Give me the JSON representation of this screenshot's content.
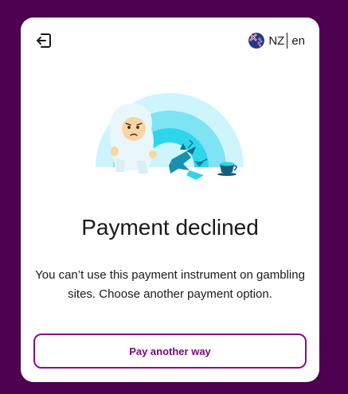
{
  "header": {
    "exit_icon": "exit-door-arrow-icon",
    "locale": {
      "flag_icon": "new-zealand-flag-icon",
      "country": "NZ",
      "language": "en"
    }
  },
  "illustration": {
    "icon": "yeti-with-broken-ice-and-teacup-illustration"
  },
  "main": {
    "title": "Payment declined",
    "message": "You can’t use this payment instrument on gambling sites. Choose another payment option."
  },
  "actions": {
    "pay_another_way_label": "Pay another way"
  },
  "colors": {
    "background": "#4d0150",
    "card": "#ffffff",
    "accent": "#8a0a8a",
    "text": "#1a1a1a"
  }
}
